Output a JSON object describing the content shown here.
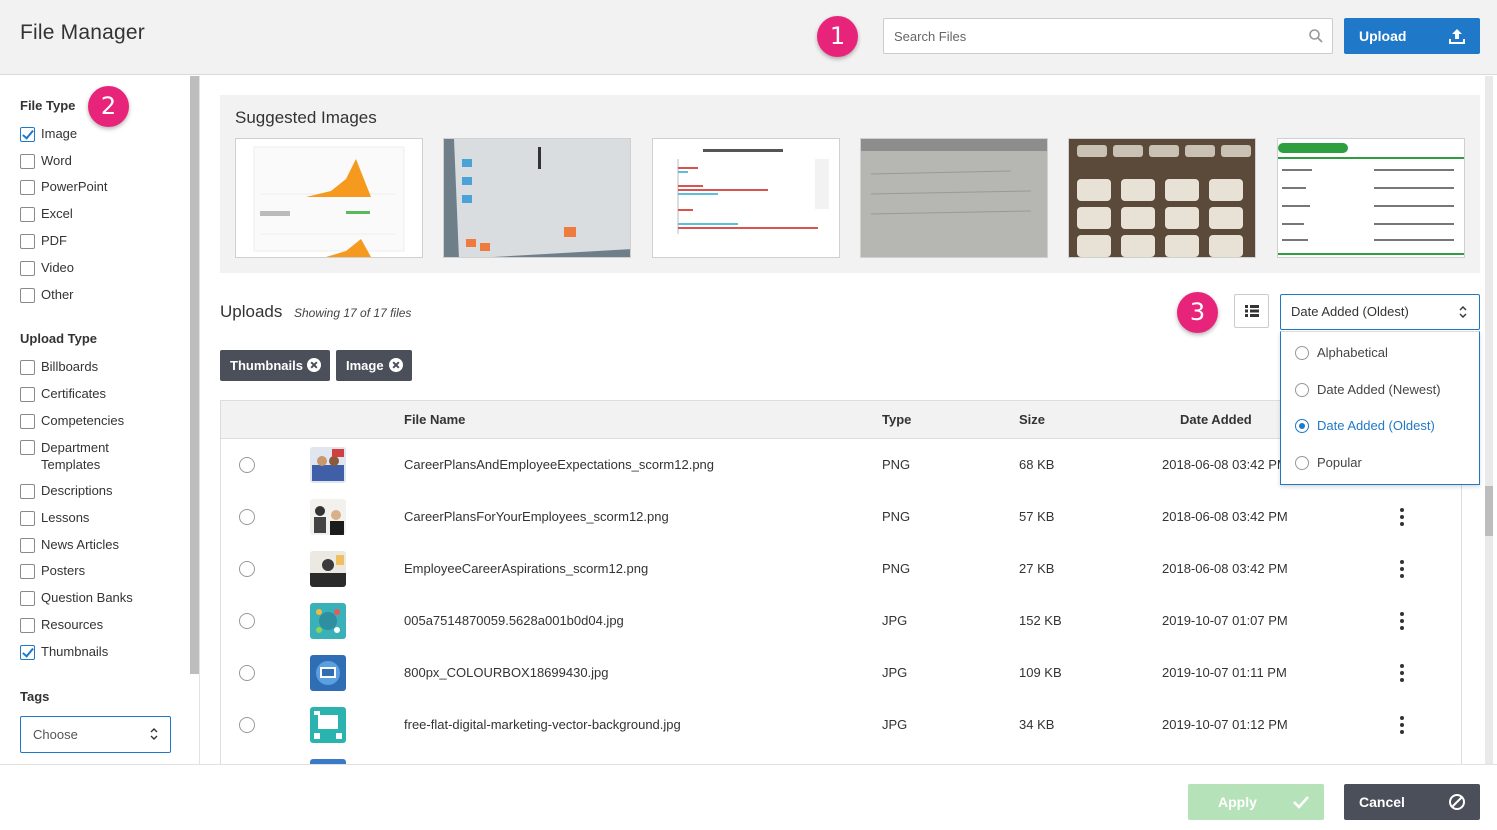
{
  "header": {
    "title": "File Manager",
    "search_placeholder": "Search Files",
    "upload_label": "Upload",
    "badges": [
      "1",
      "2",
      "3"
    ]
  },
  "sidebar": {
    "file_type_title": "File Type",
    "file_types": [
      {
        "label": "Image",
        "checked": true
      },
      {
        "label": "Word",
        "checked": false
      },
      {
        "label": "PowerPoint",
        "checked": false
      },
      {
        "label": "Excel",
        "checked": false
      },
      {
        "label": "PDF",
        "checked": false
      },
      {
        "label": "Video",
        "checked": false
      },
      {
        "label": "Other",
        "checked": false
      }
    ],
    "upload_type_title": "Upload Type",
    "upload_types": [
      {
        "label": "Billboards",
        "checked": false
      },
      {
        "label": "Certificates",
        "checked": false
      },
      {
        "label": "Competencies",
        "checked": false
      },
      {
        "label": "Department Templates",
        "checked": false
      },
      {
        "label": "Descriptions",
        "checked": false
      },
      {
        "label": "Lessons",
        "checked": false
      },
      {
        "label": "News Articles",
        "checked": false
      },
      {
        "label": "Posters",
        "checked": false
      },
      {
        "label": "Question Banks",
        "checked": false
      },
      {
        "label": "Resources",
        "checked": false
      },
      {
        "label": "Thumbnails",
        "checked": true
      }
    ],
    "tags_title": "Tags",
    "tags_value": "Choose"
  },
  "suggested": {
    "title": "Suggested Images"
  },
  "uploads": {
    "title": "Uploads",
    "count": "Showing 17 of 17 files",
    "sort_value": "Date Added (Oldest)",
    "sort_options": [
      {
        "label": "Alphabetical",
        "selected": false
      },
      {
        "label": "Date Added (Newest)",
        "selected": false
      },
      {
        "label": "Date Added (Oldest)",
        "selected": true
      },
      {
        "label": "Popular",
        "selected": false
      }
    ],
    "chips": [
      "Thumbnails",
      "Image"
    ],
    "columns": [
      "File Name",
      "Type",
      "Size",
      "Date Added"
    ],
    "rows": [
      {
        "name": "CareerPlansAndEmployeeExpectations_scorm12.png",
        "type": "PNG",
        "size": "68 KB",
        "date": "2018-06-08 03:42 PM"
      },
      {
        "name": "CareerPlansForYourEmployees_scorm12.png",
        "type": "PNG",
        "size": "57 KB",
        "date": "2018-06-08 03:42 PM"
      },
      {
        "name": "EmployeeCareerAspirations_scorm12.png",
        "type": "PNG",
        "size": "27 KB",
        "date": "2018-06-08 03:42 PM"
      },
      {
        "name": "005a7514870059.5628a001b0d04.jpg",
        "type": "JPG",
        "size": "152 KB",
        "date": "2019-10-07 01:07 PM"
      },
      {
        "name": "800px_COLOURBOX18699430.jpg",
        "type": "JPG",
        "size": "109 KB",
        "date": "2019-10-07 01:11 PM"
      },
      {
        "name": "free-flat-digital-marketing-vector-background.jpg",
        "type": "JPG",
        "size": "34 KB",
        "date": "2019-10-07 01:12 PM"
      }
    ]
  },
  "footer": {
    "apply_label": "Apply",
    "cancel_label": "Cancel"
  },
  "colors": {
    "accent": "#1f78c8",
    "badge": "#e8247a",
    "chip": "#4a4f5a",
    "apply_disabled": "#b5e2b9"
  }
}
